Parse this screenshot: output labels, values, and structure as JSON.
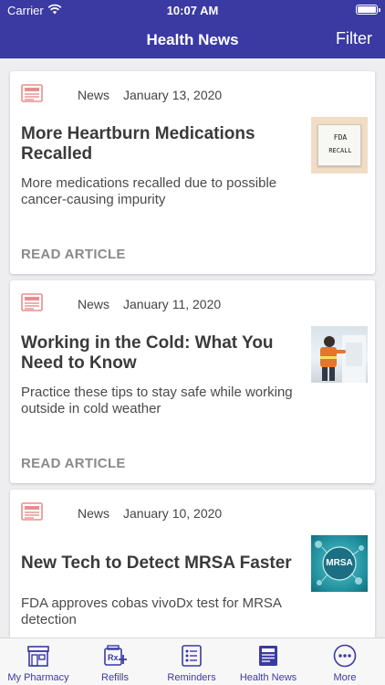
{
  "status_bar": {
    "carrier": "Carrier",
    "time": "10:07 AM"
  },
  "nav": {
    "title": "Health News",
    "filter_label": "Filter"
  },
  "articles": [
    {
      "category": "News",
      "date": "January 13, 2020",
      "title": "More Heartburn Medications Recalled",
      "description": "More medications recalled due to possible cancer-causing impurity",
      "thumb_text_1": "FDA",
      "thumb_text_2": "RECALL",
      "read_label": "READ ARTICLE"
    },
    {
      "category": "News",
      "date": "January 11, 2020",
      "title": "Working in the Cold: What You Need to Know",
      "description": "Practice these tips to stay safe while working outside in cold weather",
      "read_label": "READ ARTICLE"
    },
    {
      "category": "News",
      "date": "January 10, 2020",
      "title": "New Tech to Detect MRSA Faster",
      "description": "FDA approves cobas vivoDx test for MRSA detection",
      "thumb_text_1": "MRSA"
    }
  ],
  "tabs": [
    {
      "label": "My Pharmacy",
      "icon": "pharmacy-store-icon"
    },
    {
      "label": "Refills",
      "icon": "rx-refill-icon",
      "icon_text": "Rx"
    },
    {
      "label": "Reminders",
      "icon": "checklist-icon"
    },
    {
      "label": "Health News",
      "icon": "newspaper-icon",
      "selected": true
    },
    {
      "label": "More",
      "icon": "more-dots-icon"
    }
  ],
  "colors": {
    "brand": "#3b3aa3",
    "news_icon": "#e88e8e",
    "background": "#eeeef0"
  }
}
